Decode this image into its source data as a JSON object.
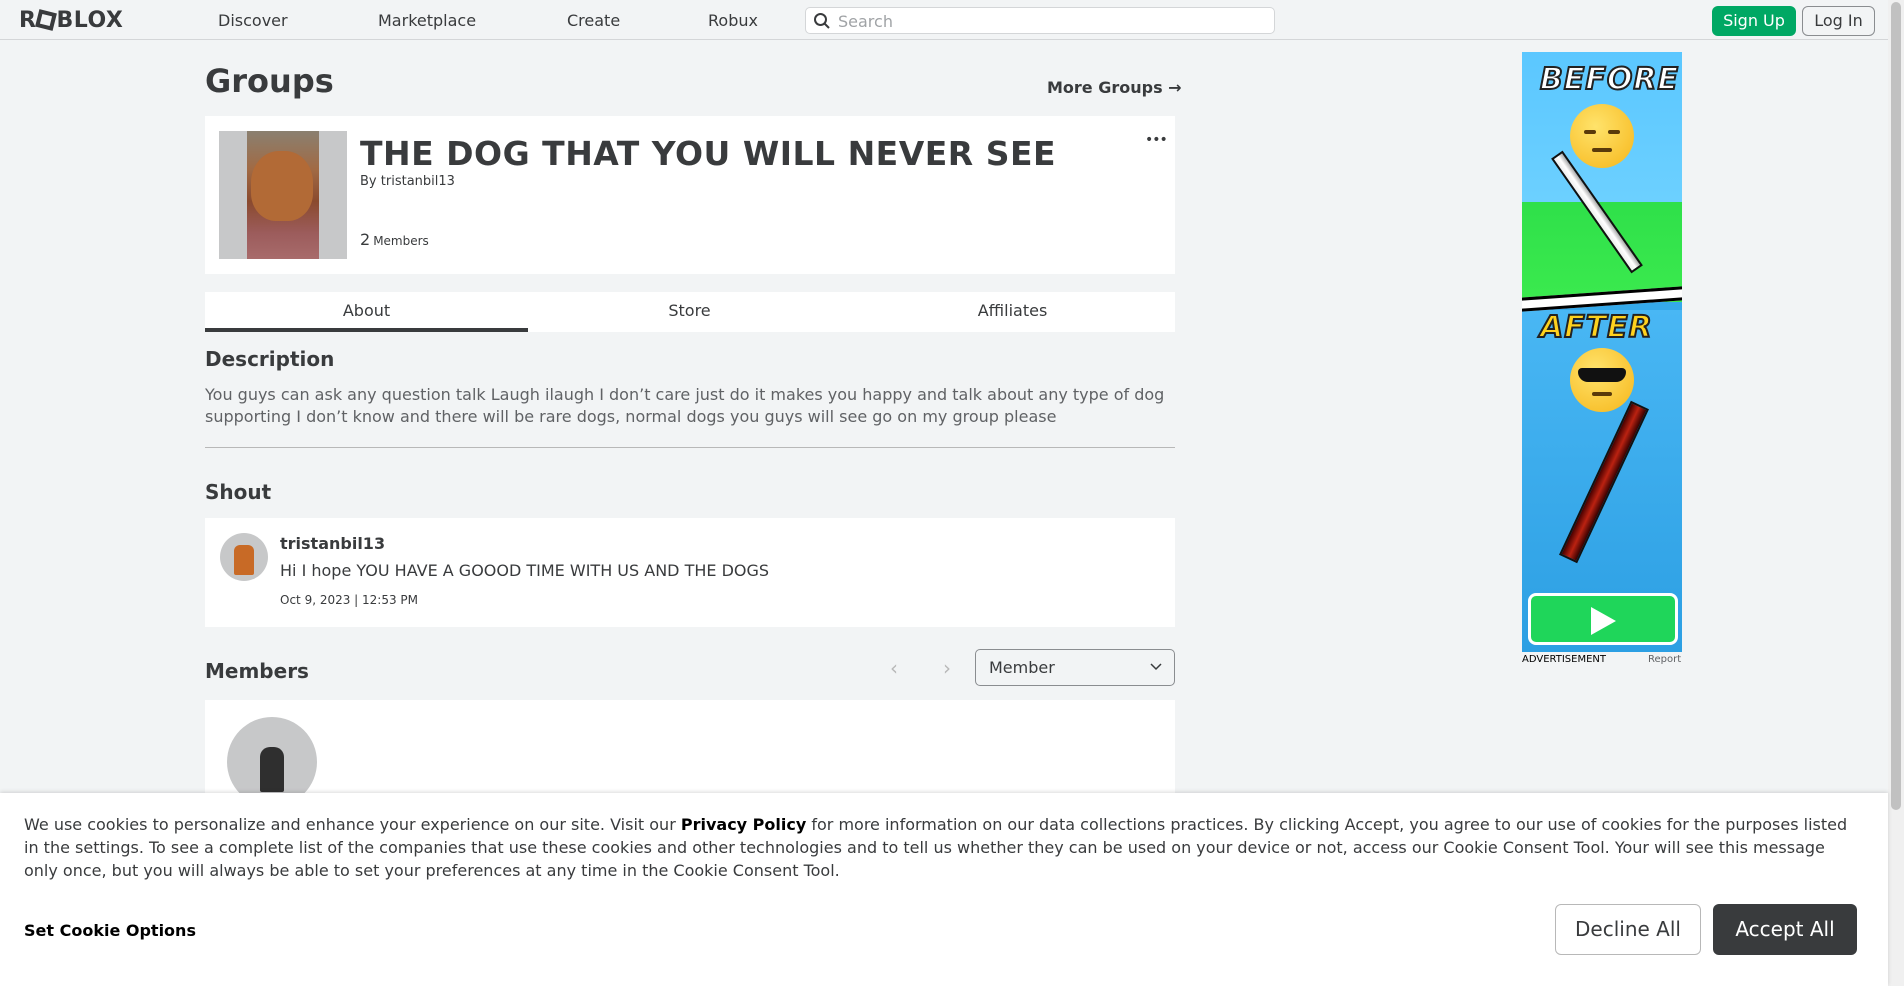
{
  "header": {
    "logo": "ROBLOX",
    "nav": [
      "Discover",
      "Marketplace",
      "Create",
      "Robux"
    ],
    "search_placeholder": "Search",
    "signup_label": "Sign Up",
    "login_label": "Log In"
  },
  "page": {
    "title": "Groups",
    "more_groups": "More Groups →"
  },
  "group": {
    "name": "THE DOG THAT YOU WILL NEVER SEE",
    "by_prefix": "By",
    "owner": "tristanbil13",
    "member_count": "2",
    "member_label": "Members",
    "more_icon": "•••"
  },
  "tabs": [
    "About",
    "Store",
    "Affiliates"
  ],
  "description": {
    "heading": "Description",
    "text": "You guys can ask any question talk Laugh ilaugh I don’t care just do it makes you happy and talk about any type of dog supporting I don’t know and there will be rare dogs, normal dogs you guys will see go on my group please"
  },
  "shout": {
    "heading": "Shout",
    "user": "tristanbil13",
    "message": "Hi I hope YOU HAVE A GOOOD TIME WITH US AND THE DOGS",
    "time": "Oct 9, 2023 | 12:53 PM"
  },
  "members": {
    "heading": "Members",
    "role_selected": "Member"
  },
  "ad": {
    "before": "BEFORE",
    "after": "AFTER",
    "label": "ADVERTISEMENT",
    "report": "Report"
  },
  "cookie": {
    "text_1": "We use cookies to personalize and enhance your experience on our site. Visit our ",
    "privacy_link": "Privacy Policy",
    "text_2": " for more information on our data collections practices. By clicking Accept, you agree to our use of cookies for the purposes listed in the settings. To see a complete list of the companies that use these cookies and other technologies and to tell us whether they can be used on your device or not, access our Cookie Consent Tool. Your will see this message only once, but you will always be able to set your preferences at any time in the Cookie Consent Tool.",
    "set_options": "Set Cookie Options",
    "decline": "Decline All",
    "accept": "Accept All"
  },
  "colors": {
    "accent_green": "#00a864",
    "text_primary": "#393b3d",
    "background": "#f2f4f5"
  }
}
